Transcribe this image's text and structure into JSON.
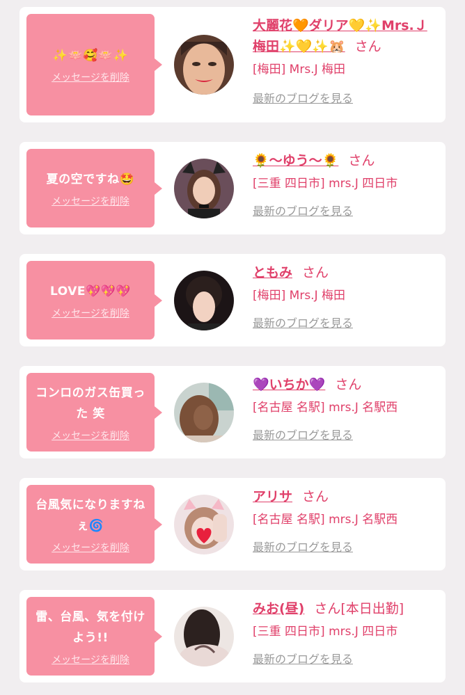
{
  "cards": [
    {
      "message": "✨🪷🥰🪷✨",
      "delete_label": "メッセージを削除",
      "name": "大麗花🧡ダリア💛✨Mrs.Ｊ梅田✨💛✨🐹",
      "honorific": "さん",
      "badge": "",
      "shop": "[梅田] Mrs.J 梅田",
      "blog_label": "最新のブログを見る"
    },
    {
      "message": "夏の空ですね🤩",
      "delete_label": "メッセージを削除",
      "name": "🌻〜ゆう〜🌻",
      "honorific": "さん",
      "badge": "",
      "shop": "[三重 四日市] mrs.J 四日市",
      "blog_label": "最新のブログを見る"
    },
    {
      "message": "LOVE💖💖💖",
      "delete_label": "メッセージを削除",
      "name": "ともみ",
      "honorific": "さん",
      "badge": "",
      "shop": "[梅田] Mrs.J 梅田",
      "blog_label": "最新のブログを見る"
    },
    {
      "message": "コンロのガス缶買った 笑",
      "delete_label": "メッセージを削除",
      "name": "💜いちか💜",
      "honorific": "さん",
      "badge": "",
      "shop": "[名古屋 名駅] mrs.J 名駅西",
      "blog_label": "最新のブログを見る"
    },
    {
      "message": "台風気になりますねぇ🌀",
      "delete_label": "メッセージを削除",
      "name": "アリサ",
      "honorific": "さん",
      "badge": "",
      "shop": "[名古屋 名駅] mrs.J 名駅西",
      "blog_label": "最新のブログを見る"
    },
    {
      "message": "雷、台風、気を付けよう!!",
      "delete_label": "メッセージを削除",
      "name": "みお(昼)",
      "honorific": "さん",
      "badge": "[本日出勤]",
      "shop": "[三重 四日市] mrs.J 四日市",
      "blog_label": "最新のブログを見る"
    }
  ]
}
